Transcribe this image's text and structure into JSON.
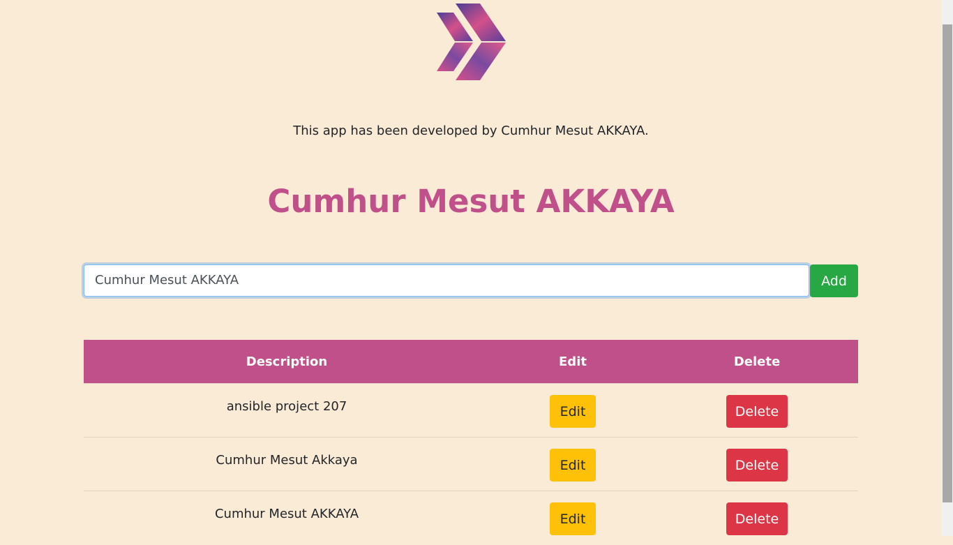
{
  "header": {
    "logo": "chevron-logo",
    "credit": "This app has been developed by Cumhur Mesut AKKAYA.",
    "title": "Cumhur Mesut AKKAYA"
  },
  "form": {
    "input_value": "Cumhur Mesut AKKAYA",
    "add_label": "Add"
  },
  "table": {
    "headers": [
      "Description",
      "Edit",
      "Delete"
    ],
    "rows": [
      {
        "description": "ansible project 207",
        "edit": "Edit",
        "delete": "Delete"
      },
      {
        "description": "Cumhur Mesut Akkaya",
        "edit": "Edit",
        "delete": "Delete"
      },
      {
        "description": "Cumhur Mesut AKKAYA",
        "edit": "Edit",
        "delete": "Delete"
      }
    ]
  },
  "colors": {
    "accent": "#c05089",
    "add": "#28a745",
    "edit": "#ffc107",
    "delete": "#dc3545",
    "background": "#faebd7"
  }
}
